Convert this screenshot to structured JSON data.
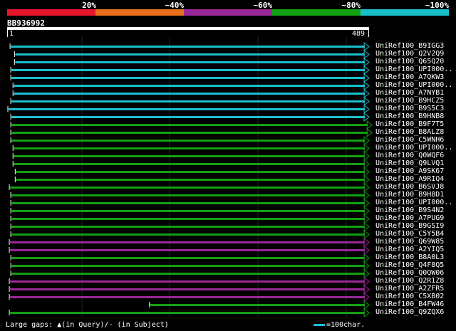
{
  "legend": {
    "labels": [
      "20%",
      "~40%",
      "~60%",
      "~80%",
      "~100%"
    ],
    "colors": [
      "#e8162d",
      "#e8711d",
      "#992899",
      "#12a012",
      "#19c0cc"
    ]
  },
  "query": {
    "name": "BB936992",
    "start": "1",
    "end": "489"
  },
  "hits": [
    {
      "label": "UniRef100_B9IGG3",
      "start": 4,
      "end": 489,
      "identity": "~100%"
    },
    {
      "label": "UniRef100_Q2V2Q9",
      "start": 10,
      "end": 489,
      "identity": "~100%"
    },
    {
      "label": "UniRef100_Q65Q20",
      "start": 10,
      "end": 489,
      "identity": "~100%"
    },
    {
      "label": "UniRef100_UPI000..",
      "start": 5,
      "end": 489,
      "identity": "~100%"
    },
    {
      "label": "UniRef100_A7QKW3",
      "start": 5,
      "end": 489,
      "identity": "~100%"
    },
    {
      "label": "UniRef100_UPI000..",
      "start": 8,
      "end": 489,
      "identity": "~100%"
    },
    {
      "label": "UniRef100_A7NYB1",
      "start": 8,
      "end": 489,
      "identity": "~100%"
    },
    {
      "label": "UniRef100_B9HCZ5",
      "start": 5,
      "end": 489,
      "identity": "~100%"
    },
    {
      "label": "UniRef100_B9S5C3",
      "start": 1,
      "end": 489,
      "identity": "~100%"
    },
    {
      "label": "UniRef100_B9HNB8",
      "start": 5,
      "end": 489,
      "identity": "~100%"
    },
    {
      "label": "UniRef100_B9F7T5",
      "start": 5,
      "end": 493,
      "identity": "~80%"
    },
    {
      "label": "UniRef100_B8ALZ8",
      "start": 5,
      "end": 493,
      "identity": "~80%"
    },
    {
      "label": "UniRef100_C5WNH6",
      "start": 5,
      "end": 489,
      "identity": "~80%"
    },
    {
      "label": "UniRef100_UPI000..",
      "start": 8,
      "end": 489,
      "identity": "~80%"
    },
    {
      "label": "UniRef100_Q0WQF6",
      "start": 8,
      "end": 489,
      "identity": "~80%"
    },
    {
      "label": "UniRef100_Q9LVQ1",
      "start": 8,
      "end": 489,
      "identity": "~80%"
    },
    {
      "label": "UniRef100_A9SK67",
      "start": 11,
      "end": 489,
      "identity": "~80%"
    },
    {
      "label": "UniRef100_A9RIQ4",
      "start": 11,
      "end": 489,
      "identity": "~80%"
    },
    {
      "label": "UniRef100_B6SVJ8",
      "start": 3,
      "end": 489,
      "identity": "~80%"
    },
    {
      "label": "UniRef100_B9H8D1",
      "start": 5,
      "end": 489,
      "identity": "~80%"
    },
    {
      "label": "UniRef100_UPI000..",
      "start": 5,
      "end": 489,
      "identity": "~80%"
    },
    {
      "label": "UniRef100_B9S4N2",
      "start": 5,
      "end": 489,
      "identity": "~80%"
    },
    {
      "label": "UniRef100_A7PUG9",
      "start": 5,
      "end": 489,
      "identity": "~80%"
    },
    {
      "label": "UniRef100_B9GSI9",
      "start": 5,
      "end": 489,
      "identity": "~80%"
    },
    {
      "label": "UniRef100_C5Y5B4",
      "start": 5,
      "end": 489,
      "identity": "~80%"
    },
    {
      "label": "UniRef100_Q69W85",
      "start": 3,
      "end": 489,
      "identity": "~60%"
    },
    {
      "label": "UniRef100_A2YIQ5",
      "start": 3,
      "end": 489,
      "identity": "~60%"
    },
    {
      "label": "UniRef100_B8A0L3",
      "start": 5,
      "end": 489,
      "identity": "~80%"
    },
    {
      "label": "UniRef100_Q4F8Q5",
      "start": 5,
      "end": 489,
      "identity": "~80%"
    },
    {
      "label": "UniRef100_Q0QW06",
      "start": 5,
      "end": 489,
      "identity": "~80%"
    },
    {
      "label": "UniRef100_Q2R1Z8",
      "start": 3,
      "end": 489,
      "identity": "~60%"
    },
    {
      "label": "UniRef100_A2ZFR5",
      "start": 3,
      "end": 489,
      "identity": "~60%"
    },
    {
      "label": "UniRef100_C5XB02",
      "start": 3,
      "end": 489,
      "identity": "~60%"
    },
    {
      "label": "UniRef100_B4FW46",
      "start": 193,
      "end": 489,
      "identity": "~80%"
    },
    {
      "label": "UniRef100_Q9ZQX6",
      "start": 3,
      "end": 489,
      "identity": "~80%"
    }
  ],
  "footer": {
    "gaps_text": "Large gaps: ▲(in Query)/- (in Subject)",
    "scale_text": "=100char.",
    "scale_color": "#19c0cc"
  }
}
